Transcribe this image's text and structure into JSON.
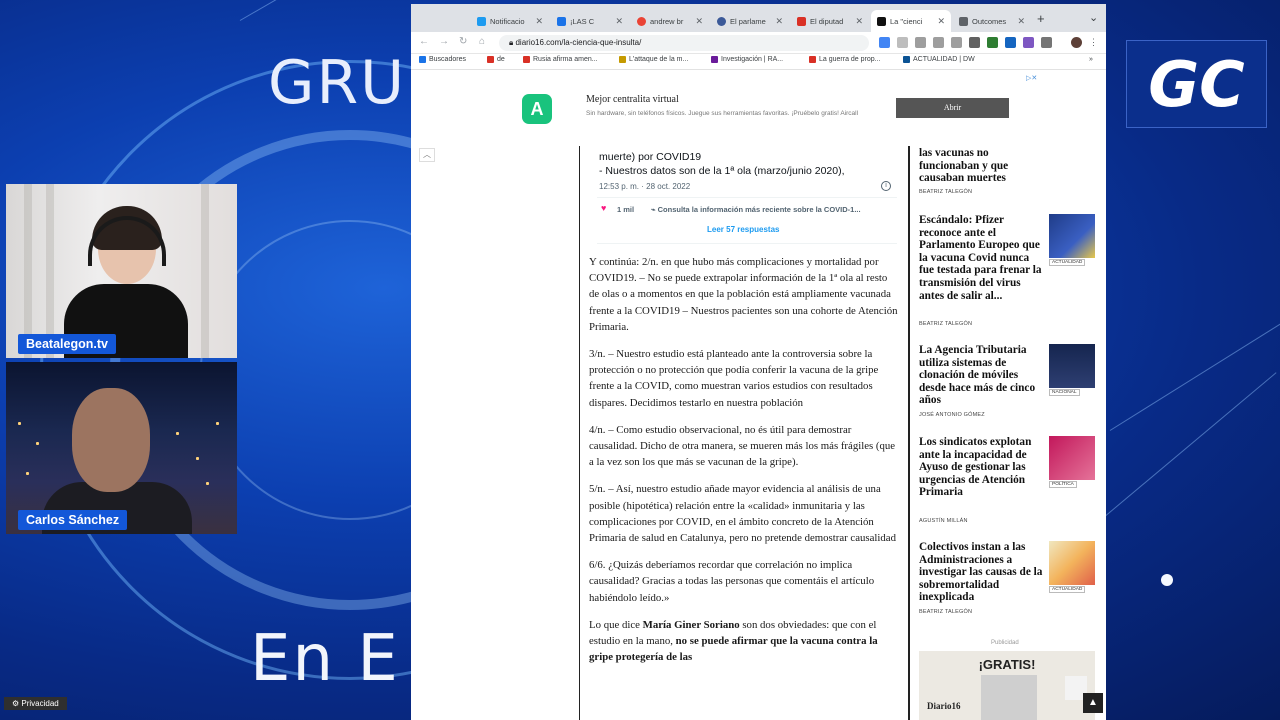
{
  "stream": {
    "brand_top": "GRU",
    "brand_bottom": "En E",
    "logo": "GC",
    "participants": [
      {
        "name": "Beatalegon.tv"
      },
      {
        "name": "Carlos Sánchez"
      }
    ]
  },
  "browser": {
    "tabs": [
      {
        "label": "Notificacio",
        "icon": "twitter-icon",
        "color": "#1d9bf0"
      },
      {
        "label": "¡LAS C",
        "icon": "ai-icon",
        "color": "#1a73e8"
      },
      {
        "label": "andrew br",
        "icon": "google-icon",
        "color": "#ea4335"
      },
      {
        "label": "El parlame",
        "icon": "site-icon",
        "color": "#3b5998"
      },
      {
        "label": "El diputad",
        "icon": "gmail-icon",
        "color": "#d93025"
      },
      {
        "label": "La \"cienci",
        "icon": "diario16-icon",
        "color": "#111111",
        "active": true
      },
      {
        "label": "Outcomes",
        "icon": "site-icon",
        "color": "#5f6368"
      }
    ],
    "url": "diario16.com/la-ciencia-que-insulta/",
    "bookmarks": [
      {
        "label": "Buscadores",
        "color": "#1a73e8"
      },
      {
        "label": "de",
        "color": "#d93025"
      },
      {
        "label": "Rusia afirma amen...",
        "color": "#d93025"
      },
      {
        "label": "L'attaque de la m...",
        "color": "#c59a00"
      },
      {
        "label": "Investigación | RA...",
        "color": "#6a1b9a"
      },
      {
        "label": "La guerra de prop...",
        "color": "#d93025"
      },
      {
        "label": "ACTUALIDAD | DW",
        "color": "#0b5394"
      }
    ]
  },
  "ad": {
    "logo_letter": "A",
    "title": "Mejor centralita virtual",
    "description": "Sin hardware, sin teléfonos físicos. Juegue sus herramientas favoritas. ¡Pruébelo gratis! Aircall",
    "button": "Abrir",
    "privacy": "Privacidad"
  },
  "tweet": {
    "line1": "muerte) por COVID19",
    "line2": "- Nuestros datos son de la 1ª ola (marzo/junio 2020),",
    "timestamp": "12:53 p. m. · 28 oct. 2022",
    "likes": "1 mil",
    "covid_info": "Consulta la información más reciente sobre la COVID-1...",
    "replies": "Leer 57 respuestas"
  },
  "article": {
    "p1": "Y continúa: 2/n. en que hubo más complicaciones y mortalidad por COVID19. – No se puede extrapolar información de la 1ª ola al resto de olas o a momentos en que la población está ampliamente vacunada frente a la COVID19 – Nuestros pacientes son una cohorte de Atención Primaria.",
    "p2": "3/n. – Nuestro estudio está planteado ante la controversia sobre la protección o no protección que podía conferir la vacuna de la gripe frente a la COVID, como muestran varios estudios con resultados dispares. Decidimos testarlo en nuestra población",
    "p3": "4/n. – Como estudio observacional, no és útil para demostrar causalidad. Dicho de otra manera, se mueren más los más frágiles (que a la vez son los que más se vacunan de la gripe).",
    "p4": "5/n. – Así, nuestro estudio añade mayor evidencia al análisis de una posible (hipotética) relación entre la «calidad» inmunitaria y las complicaciones por COVID, en el ámbito concreto de la Atención Primaria de salud en Catalunya, pero no pretende demostrar causalidad",
    "p5": "6/6. ¿Quizás deberíamos recordar que correlación no implica causalidad? Gracias a todas las personas que comentáis el artículo habiéndolo leído.»",
    "p6_start": "Lo que dice ",
    "p6_name": "María Giner Soriano",
    "p6_mid": " son dos obviedades: que con el estudio en la mano, ",
    "p6_bold": "no se puede afirmar que la vacuna contra la gripe protegería de las"
  },
  "sidebar": {
    "items": [
      {
        "title": "las vacunas no funcionaban y que causaban muertes",
        "author": "BEATRIZ TALEGÓN",
        "tag": ""
      },
      {
        "title": "Escándalo: Pfizer reconoce ante el Parlamento Europeo que la vacuna Covid nunca fue testada para frenar la transmisión del virus antes de salir al...",
        "author": "BEATRIZ TALEGÓN",
        "tag": "ACTUALIDAD"
      },
      {
        "title": "La Agencia Tributaria utiliza sistemas de clonación de móviles desde hace más de cinco años",
        "author": "JOSÉ ANTONIO GÓMEZ",
        "tag": "NACIONAL"
      },
      {
        "title": "Los sindicatos explotan ante la incapacidad de Ayuso de gestionar las urgencias de Atención Primaria",
        "author": "AGUSTÍN MILLÁN",
        "tag": "POLÍTICA"
      },
      {
        "title": "Colectivos instan a las Administraciones a investigar las causas de la sobremortalidad inexplicada",
        "author": "BEATRIZ TALEGÓN",
        "tag": "ACTUALIDAD"
      }
    ],
    "ad_label": "Publicidad",
    "promo_title": "¡GRATIS!",
    "promo_brand": "Diario16"
  }
}
